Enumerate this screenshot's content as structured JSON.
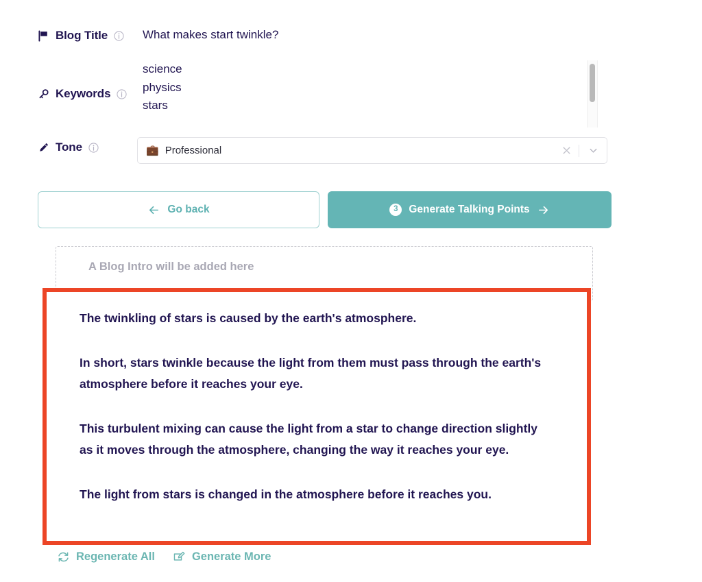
{
  "form": {
    "blog_title": {
      "icon": "flag-icon",
      "label": "Blog Title",
      "info_icon": "info-icon",
      "value": "What makes start twinkle?"
    },
    "keywords": {
      "icon": "key-icon",
      "label": "Keywords",
      "info_icon": "info-icon",
      "items": [
        "science",
        "physics",
        "stars"
      ]
    },
    "tone": {
      "icon": "pen-icon",
      "label": "Tone",
      "info_icon": "info-icon",
      "selected_emoji": "💼",
      "selected_value": "Professional",
      "clear_icon": "close-icon",
      "dropdown_icon": "chevron-down-icon"
    }
  },
  "actions": {
    "go_back": {
      "label": "Go back",
      "icon": "arrow-left-icon"
    },
    "generate": {
      "step": "3",
      "label": "Generate Talking Points",
      "icon": "arrow-right-icon"
    }
  },
  "intro_placeholder": {
    "text": "A Blog Intro will be added here"
  },
  "talking_points": [
    "The twinkling of stars is caused by the earth's atmosphere.",
    "In short, stars twinkle because the light from them must pass through the earth's atmosphere before it reaches your eye.",
    "This turbulent mixing can cause the light from a star to change direction slightly as it moves through the atmosphere, changing the way it reaches your eye.",
    "The light from stars is changed in the atmosphere before it reaches you."
  ],
  "footer": {
    "regenerate_all": {
      "label": "Regenerate All",
      "icon": "refresh-icon"
    },
    "generate_more": {
      "label": "Generate More",
      "icon": "edit-square-icon"
    }
  },
  "colors": {
    "teal": "#64b5b5",
    "navy": "#211551",
    "highlight_red": "#ec4526",
    "muted_gray": "#a9a8b4"
  }
}
